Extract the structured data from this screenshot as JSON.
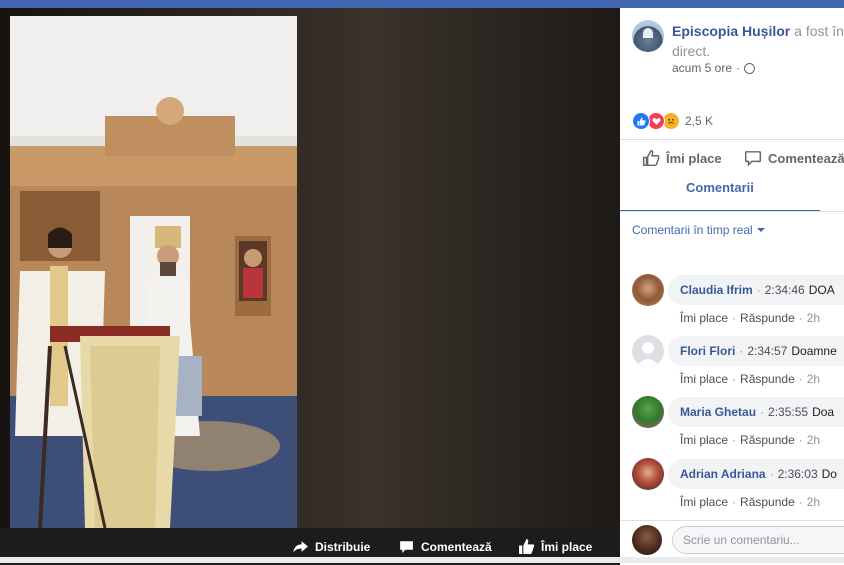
{
  "page": {
    "name": "Episcopia Hușilor",
    "status_suffix": "a fost în direct.",
    "time_ago": "acum 5 ore",
    "dot": "·"
  },
  "reactions": {
    "count": "2,5 K"
  },
  "actions": {
    "like": "Îmi place",
    "comment": "Comentează"
  },
  "tabs": {
    "comments": "Comentarii"
  },
  "filter": {
    "label": "Comentarii în timp real"
  },
  "comments": [
    {
      "name": "Claudia Ifrim",
      "time": "2:34:46",
      "text": "DOA"
    },
    {
      "name": "Flori Flori",
      "time": "2:34:57",
      "text": "Doamne"
    },
    {
      "name": "Maria Ghetau",
      "time": "2:35:55",
      "text": "Doa"
    },
    {
      "name": "Adrian Adriana",
      "time": "2:36:03",
      "text": "Do"
    }
  ],
  "comment_actions": {
    "like": "Îmi place",
    "reply": "Răspunde",
    "ago": "2h",
    "sep": "·"
  },
  "composer": {
    "placeholder": "Scrie un comentariu..."
  },
  "video_bar": {
    "share": "Distribuie",
    "comment": "Comentează",
    "like": "Îmi place"
  },
  "colors": {
    "brand": "#4267b2",
    "link": "#365899"
  }
}
